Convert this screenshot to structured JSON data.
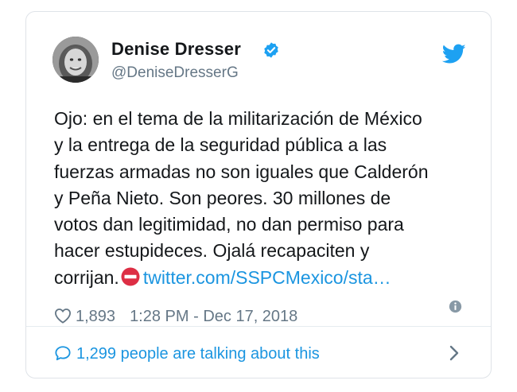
{
  "tweet": {
    "author_name": "Denise Dresser",
    "author_handle": "@DeniseDresserG",
    "body_lines": [
      "Ojo: en el tema de la militarización de México",
      "y la entrega de la seguridad pública a las",
      "fuerzas armadas no son iguales que Calderón",
      "y Peña Nieto. Son peores. 30 millones de",
      "votos dan legitimidad, no dan permiso para",
      "hacer estupideces. Ojalá recapaciten y"
    ],
    "last_line_text": "corrijan.",
    "link_text": "twitter.com/SSPCMexico/sta…",
    "like_count": "1,893",
    "timestamp": "1:28 PM - Dec 17, 2018",
    "talking_text": "1,299 people are talking about this"
  },
  "icons": {
    "verified": "verified-badge-icon",
    "brand": "twitter-bird-icon",
    "emoji": "no-entry-icon",
    "like": "heart-icon",
    "info": "info-icon",
    "reply": "speech-bubble-icon",
    "more": "chevron-right-icon"
  },
  "colors": {
    "accent": "#1b95e0",
    "secondary_text": "#657786",
    "primary_text": "#14171a",
    "no_entry_red": "#dd2e44"
  }
}
